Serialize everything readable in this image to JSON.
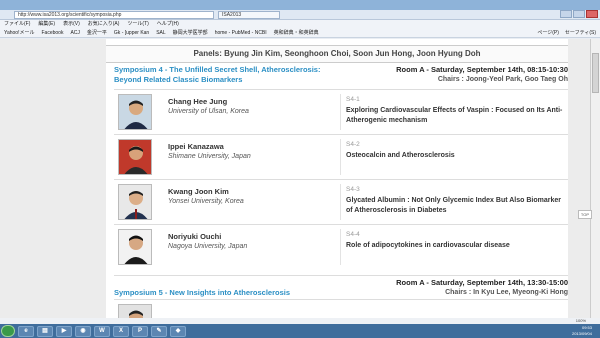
{
  "browser": {
    "url": "http://www.isa2013.org/scientific/symposia.php",
    "tab": "ISA2013",
    "menu": [
      "ファイル(F)",
      "編集(E)",
      "表示(V)",
      "お気に入り(A)",
      "ツール(T)",
      "ヘルプ(H)"
    ],
    "favorites": [
      "Yahoo!メール",
      "Facebook",
      "ACJ",
      "金沢一平",
      "Gk - [upper Kan",
      "SAL",
      "静岡大学医学部",
      "home - PubMed - NCBI",
      "英和辞典・和英辞典"
    ],
    "toolbar_right": [
      "ページ(P)",
      "セーフティ(S)"
    ],
    "zoom": "100%",
    "top_button": "TOP",
    "clock_time": "09:53",
    "clock_date": "2013/09/04"
  },
  "program": {
    "panels": "Panels: Byung Jin Kim, Seonghoon Choi, Soon Jun Hong, Joon Hyung Doh",
    "symposium4": {
      "title_line1": "Symposium 4 - The Unfilled Secret Shell, Atherosclerosis:",
      "title_line2": "Beyond Related Classic Biomarkers",
      "room": "Room A - Saturday, September 14th, 08:15-10:30",
      "chairs": "Chairs : Joong-Yeol Park, Goo Taeg Oh"
    },
    "talks": [
      {
        "name": "Chang Hee Jung",
        "affiliation": "University of Ulsan, Korea",
        "code": "S4-1",
        "title": "Exploring Cardiovascular Effects of Vaspin : Focused on Its Anti-Atherogenic mechanism"
      },
      {
        "name": "Ippei Kanazawa",
        "affiliation": "Shimane University, Japan",
        "code": "S4-2",
        "title": "Osteocalcin and Atherosclerosis"
      },
      {
        "name": "Kwang Joon Kim",
        "affiliation": "Yonsei University, Korea",
        "code": "S4-3",
        "title": "Glycated Albumin : Not Only Glycemic Index But Also Biomarker of Atherosclerosis in Diabetes"
      },
      {
        "name": "Noriyuki Ouchi",
        "affiliation": "Nagoya University, Japan",
        "code": "S4-4",
        "title": "Role of adipocytokines in cardiovascular disease"
      }
    ],
    "symposium5": {
      "title": "Symposium 5 - New Insights into Atherosclerosis",
      "room": "Room A - Saturday, September 14th, 13:30-15:00",
      "chairs": "Chairs : In Kyu Lee, Myeong-Ki Hong"
    }
  },
  "colors": {
    "link_blue": "#2b8fc4",
    "taskbar": "#3f6d9c",
    "titlebar": "#8eb3d9"
  }
}
